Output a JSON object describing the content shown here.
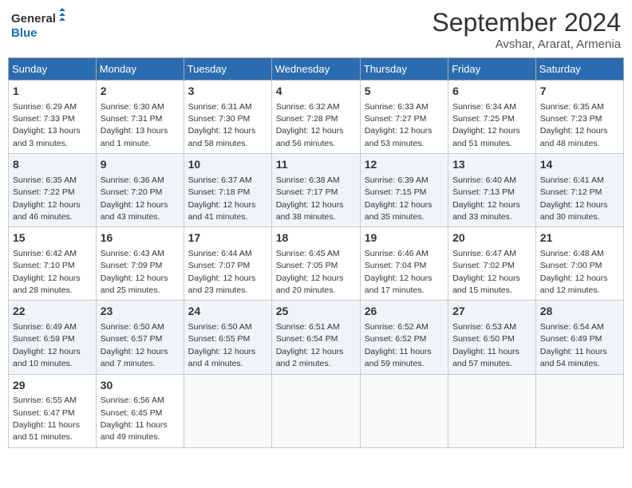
{
  "header": {
    "logo_line1": "General",
    "logo_line2": "Blue",
    "month_title": "September 2024",
    "subtitle": "Avshar, Ararat, Armenia"
  },
  "weekdays": [
    "Sunday",
    "Monday",
    "Tuesday",
    "Wednesday",
    "Thursday",
    "Friday",
    "Saturday"
  ],
  "weeks": [
    [
      {
        "day": "1",
        "sunrise": "6:29 AM",
        "sunset": "7:33 PM",
        "daylight": "13 hours and 3 minutes."
      },
      {
        "day": "2",
        "sunrise": "6:30 AM",
        "sunset": "7:31 PM",
        "daylight": "13 hours and 1 minute."
      },
      {
        "day": "3",
        "sunrise": "6:31 AM",
        "sunset": "7:30 PM",
        "daylight": "12 hours and 58 minutes."
      },
      {
        "day": "4",
        "sunrise": "6:32 AM",
        "sunset": "7:28 PM",
        "daylight": "12 hours and 56 minutes."
      },
      {
        "day": "5",
        "sunrise": "6:33 AM",
        "sunset": "7:27 PM",
        "daylight": "12 hours and 53 minutes."
      },
      {
        "day": "6",
        "sunrise": "6:34 AM",
        "sunset": "7:25 PM",
        "daylight": "12 hours and 51 minutes."
      },
      {
        "day": "7",
        "sunrise": "6:35 AM",
        "sunset": "7:23 PM",
        "daylight": "12 hours and 48 minutes."
      }
    ],
    [
      {
        "day": "8",
        "sunrise": "6:35 AM",
        "sunset": "7:22 PM",
        "daylight": "12 hours and 46 minutes."
      },
      {
        "day": "9",
        "sunrise": "6:36 AM",
        "sunset": "7:20 PM",
        "daylight": "12 hours and 43 minutes."
      },
      {
        "day": "10",
        "sunrise": "6:37 AM",
        "sunset": "7:18 PM",
        "daylight": "12 hours and 41 minutes."
      },
      {
        "day": "11",
        "sunrise": "6:38 AM",
        "sunset": "7:17 PM",
        "daylight": "12 hours and 38 minutes."
      },
      {
        "day": "12",
        "sunrise": "6:39 AM",
        "sunset": "7:15 PM",
        "daylight": "12 hours and 35 minutes."
      },
      {
        "day": "13",
        "sunrise": "6:40 AM",
        "sunset": "7:13 PM",
        "daylight": "12 hours and 33 minutes."
      },
      {
        "day": "14",
        "sunrise": "6:41 AM",
        "sunset": "7:12 PM",
        "daylight": "12 hours and 30 minutes."
      }
    ],
    [
      {
        "day": "15",
        "sunrise": "6:42 AM",
        "sunset": "7:10 PM",
        "daylight": "12 hours and 28 minutes."
      },
      {
        "day": "16",
        "sunrise": "6:43 AM",
        "sunset": "7:09 PM",
        "daylight": "12 hours and 25 minutes."
      },
      {
        "day": "17",
        "sunrise": "6:44 AM",
        "sunset": "7:07 PM",
        "daylight": "12 hours and 23 minutes."
      },
      {
        "day": "18",
        "sunrise": "6:45 AM",
        "sunset": "7:05 PM",
        "daylight": "12 hours and 20 minutes."
      },
      {
        "day": "19",
        "sunrise": "6:46 AM",
        "sunset": "7:04 PM",
        "daylight": "12 hours and 17 minutes."
      },
      {
        "day": "20",
        "sunrise": "6:47 AM",
        "sunset": "7:02 PM",
        "daylight": "12 hours and 15 minutes."
      },
      {
        "day": "21",
        "sunrise": "6:48 AM",
        "sunset": "7:00 PM",
        "daylight": "12 hours and 12 minutes."
      }
    ],
    [
      {
        "day": "22",
        "sunrise": "6:49 AM",
        "sunset": "6:59 PM",
        "daylight": "12 hours and 10 minutes."
      },
      {
        "day": "23",
        "sunrise": "6:50 AM",
        "sunset": "6:57 PM",
        "daylight": "12 hours and 7 minutes."
      },
      {
        "day": "24",
        "sunrise": "6:50 AM",
        "sunset": "6:55 PM",
        "daylight": "12 hours and 4 minutes."
      },
      {
        "day": "25",
        "sunrise": "6:51 AM",
        "sunset": "6:54 PM",
        "daylight": "12 hours and 2 minutes."
      },
      {
        "day": "26",
        "sunrise": "6:52 AM",
        "sunset": "6:52 PM",
        "daylight": "11 hours and 59 minutes."
      },
      {
        "day": "27",
        "sunrise": "6:53 AM",
        "sunset": "6:50 PM",
        "daylight": "11 hours and 57 minutes."
      },
      {
        "day": "28",
        "sunrise": "6:54 AM",
        "sunset": "6:49 PM",
        "daylight": "11 hours and 54 minutes."
      }
    ],
    [
      {
        "day": "29",
        "sunrise": "6:55 AM",
        "sunset": "6:47 PM",
        "daylight": "11 hours and 51 minutes."
      },
      {
        "day": "30",
        "sunrise": "6:56 AM",
        "sunset": "6:45 PM",
        "daylight": "11 hours and 49 minutes."
      },
      null,
      null,
      null,
      null,
      null
    ]
  ]
}
